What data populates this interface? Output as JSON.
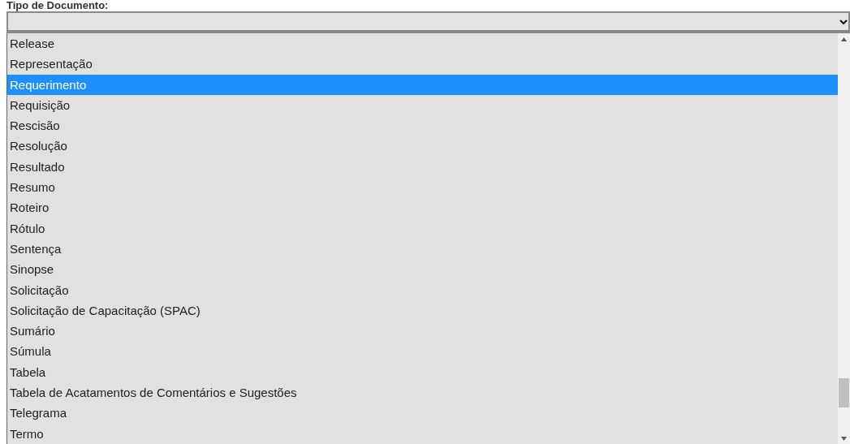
{
  "label": "Tipo de Documento:",
  "select": {
    "expanded": true
  },
  "options": [
    {
      "label": "Release",
      "selected": false
    },
    {
      "label": "Representação",
      "selected": false
    },
    {
      "label": "Requerimento",
      "selected": true
    },
    {
      "label": "Requisição",
      "selected": false
    },
    {
      "label": "Rescisão",
      "selected": false
    },
    {
      "label": "Resolução",
      "selected": false
    },
    {
      "label": "Resultado",
      "selected": false
    },
    {
      "label": "Resumo",
      "selected": false
    },
    {
      "label": "Roteiro",
      "selected": false
    },
    {
      "label": "Rótulo",
      "selected": false
    },
    {
      "label": "Sentença",
      "selected": false
    },
    {
      "label": "Sinopse",
      "selected": false
    },
    {
      "label": "Solicitação",
      "selected": false
    },
    {
      "label": "Solicitação de Capacitação (SPAC)",
      "selected": false
    },
    {
      "label": "Sumário",
      "selected": false
    },
    {
      "label": "Súmula",
      "selected": false
    },
    {
      "label": "Tabela",
      "selected": false
    },
    {
      "label": "Tabela de Acatamentos de Comentários e Sugestões",
      "selected": false
    },
    {
      "label": "Telegrama",
      "selected": false
    },
    {
      "label": "Termo",
      "selected": false
    }
  ]
}
